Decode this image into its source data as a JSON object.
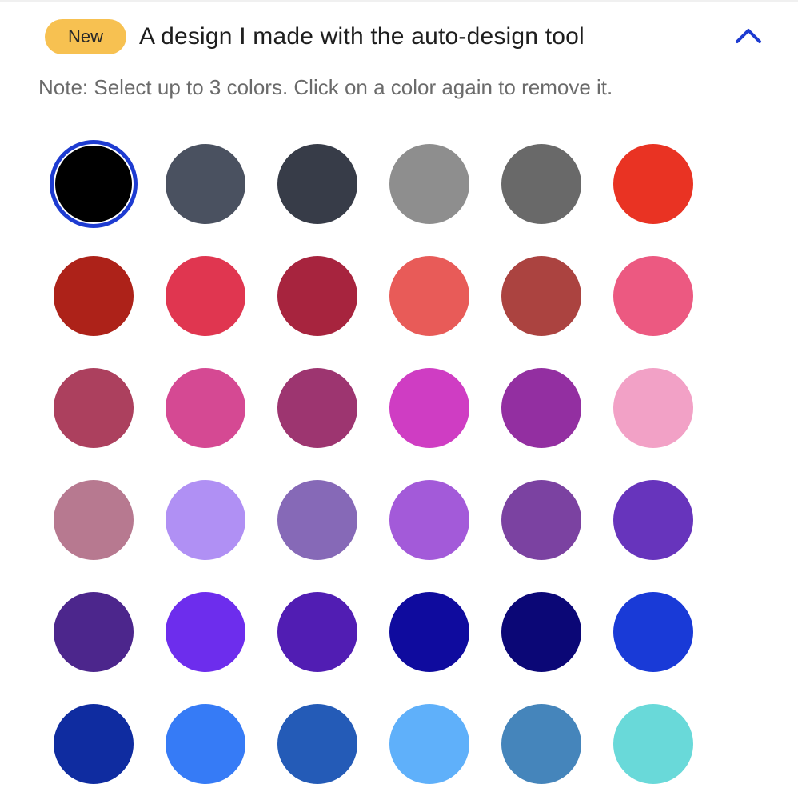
{
  "header": {
    "badge_label": "New",
    "badge_color": "#f7c151",
    "title": "A design I made with the auto-design tool",
    "collapse_icon": "chevron-up-icon",
    "accent_color": "#1d3bd1"
  },
  "note": "Note: Select up to 3 colors. Click on a color again to remove it.",
  "palette": {
    "max_selected": 3,
    "selected_color": "#000000",
    "colors": [
      "#000000",
      "#4a5160",
      "#373c48",
      "#8e8e8e",
      "#696969",
      "#e93323",
      "#ad2219",
      "#e03650",
      "#a7243e",
      "#e85b58",
      "#ab4340",
      "#ec5981",
      "#ac405e",
      "#d54993",
      "#9d3570",
      "#cf3dc3",
      "#932fa1",
      "#f2a1c6",
      "#b77990",
      "#b090f4",
      "#8669b7",
      "#a35ad9",
      "#7b42a1",
      "#6734bc",
      "#4c268c",
      "#6d2ded",
      "#511db3",
      "#0f0b9e",
      "#0b0776",
      "#193ad7",
      "#0f2ca0",
      "#367bf6",
      "#245bb7",
      "#5fb0fa",
      "#4585bb",
      "#69d9d9"
    ]
  }
}
